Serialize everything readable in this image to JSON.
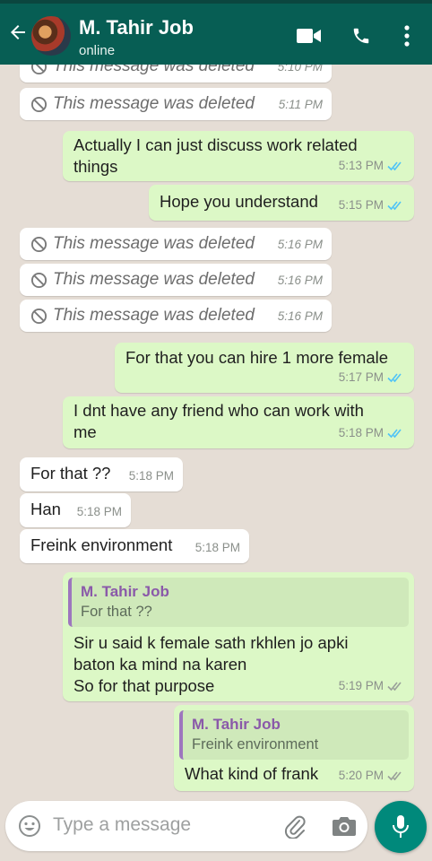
{
  "header": {
    "contact_name": "M. Tahir Job",
    "status": "online"
  },
  "messages": {
    "m0": {
      "text": "This message was deleted",
      "time": "5:10 PM"
    },
    "m1": {
      "text": "This message was deleted",
      "time": "5:11 PM"
    },
    "m2": {
      "line1": "Actually I can just discuss work related",
      "line2": "things",
      "time": "5:13 PM"
    },
    "m3": {
      "text": "Hope you understand",
      "time": "5:15 PM"
    },
    "m4": {
      "text": "This message was deleted",
      "time": "5:16 PM"
    },
    "m5": {
      "text": "This message was deleted",
      "time": "5:16 PM"
    },
    "m6": {
      "text": "This message was deleted",
      "time": "5:16 PM"
    },
    "m7": {
      "text": "For that you can hire 1 more female",
      "time": "5:17 PM"
    },
    "m8": {
      "line1": "I dnt have any friend who can work with",
      "line2": "me",
      "time": "5:18 PM"
    },
    "m9": {
      "text": "For that ??",
      "time": "5:18 PM"
    },
    "m10": {
      "text": "Han",
      "time": "5:18 PM"
    },
    "m11": {
      "text": "Freink environment",
      "time": "5:18 PM"
    },
    "m12": {
      "quote_name": "M. Tahir Job",
      "quote_text": "For that ??",
      "line1": "Sir u said k female sath rkhlen jo apki",
      "line2": "baton ka mind na karen",
      "line3": "So for that purpose",
      "time": "5:19 PM"
    },
    "m13": {
      "quote_name": "M. Tahir Job",
      "quote_text": "Freink environment",
      "text": "What kind of frank",
      "time": "5:20 PM"
    }
  },
  "composer": {
    "placeholder": "Type a message"
  },
  "icons": {
    "back": "arrow-left-icon",
    "video": "video-call-icon",
    "call": "phone-icon",
    "menu": "more-vert-icon",
    "emoji": "emoji-icon",
    "attach": "paperclip-icon",
    "camera": "camera-icon",
    "mic": "mic-icon",
    "deleted": "ban-icon",
    "read": "double-tick-icon"
  },
  "colors": {
    "header": "#075e54",
    "outgoing_bubble": "#dcf8c6",
    "incoming_bubble": "#ffffff",
    "read_tick": "#4fc3f7",
    "mic_button": "#00897b",
    "chat_background": "#e5ddd5"
  }
}
